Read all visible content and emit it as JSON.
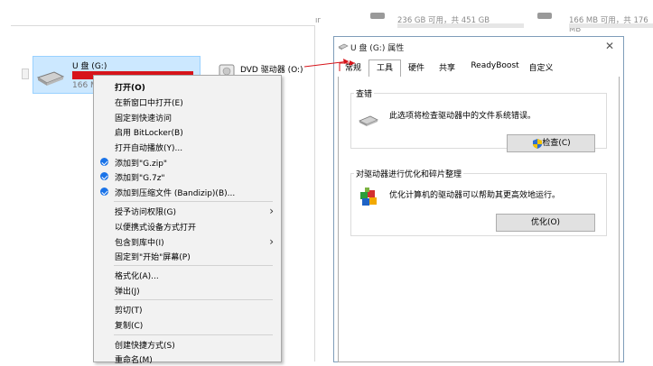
{
  "background": {
    "top_fragment_1": "ır",
    "top_fragment_2": "236 GB 可用，共 451 GB",
    "top_fragment_3": "166 MB 可用，共 176 MB"
  },
  "explorer": {
    "drive_g_label": "U 盘 (G:)",
    "drive_g_partial_size": "166 M",
    "dvd_label": "DVD 驱动器 (O:)"
  },
  "context_menu": {
    "items": [
      {
        "label": "打开(O)",
        "bold": true
      },
      {
        "label": "在新窗口中打开(E)"
      },
      {
        "label": "固定到快速访问"
      },
      {
        "label": "启用 BitLocker(B)"
      },
      {
        "label": "打开自动播放(Y)..."
      },
      {
        "label": "添加到\"G.zip\"",
        "icon": "bandizip-icon"
      },
      {
        "label": "添加到\"G.7z\"",
        "icon": "bandizip-icon"
      },
      {
        "label": "添加到压缩文件 (Bandizip)(B)...",
        "icon": "bandizip-icon"
      },
      {
        "label": "授予访问权限(G)",
        "submenu": true
      },
      {
        "label": "以便携式设备方式打开"
      },
      {
        "label": "包含到库中(I)",
        "submenu": true
      },
      {
        "label": "固定到\"开始\"屏幕(P)"
      },
      {
        "label": "格式化(A)..."
      },
      {
        "label": "弹出(J)"
      },
      {
        "label": "剪切(T)"
      },
      {
        "label": "复制(C)"
      },
      {
        "label": "创建快捷方式(S)"
      },
      {
        "label": "重命名(M)"
      }
    ]
  },
  "dialog": {
    "title": "U 盘 (G:) 属性",
    "close_glyph": "✕",
    "tabs": [
      "常规",
      "工具",
      "硬件",
      "共享",
      "ReadyBoost",
      "自定义"
    ],
    "active_tab": "工具",
    "check_group": {
      "title": "查错",
      "description": "此选项将检查驱动器中的文件系统错误。",
      "button": "检查(C)"
    },
    "optimize_group": {
      "title": "对驱动器进行优化和碎片整理",
      "description": "优化计算机的驱动器可以帮助其更高效地运行。",
      "button": "优化(O)"
    }
  },
  "colors": {
    "selection_bg": "#cce8ff",
    "drive_bar_full": "#d7141a",
    "annotation_arrow": "#d7141a",
    "bandizip_blue": "#1a73e8"
  }
}
